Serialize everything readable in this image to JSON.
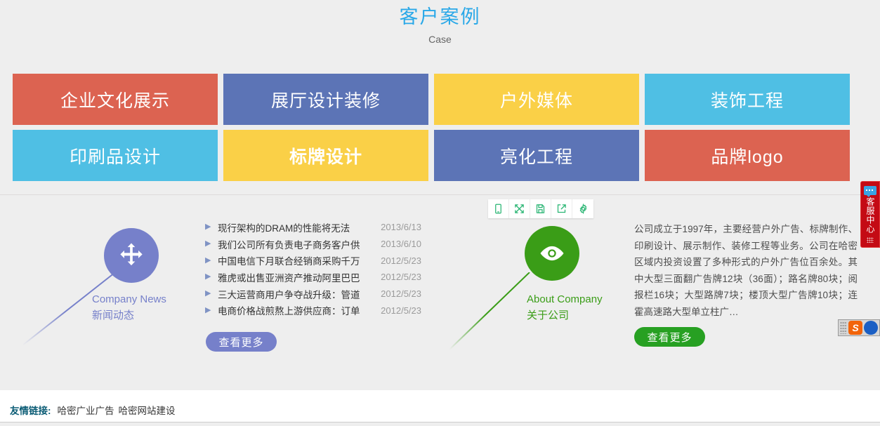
{
  "header": {
    "title": "客户案例",
    "subtitle": "Case"
  },
  "tiles": [
    {
      "label": "企业文化展示",
      "color": "#dc6351",
      "bold": false
    },
    {
      "label": "展厅设计装修",
      "color": "#5c74b6",
      "bold": false
    },
    {
      "label": "户外媒体",
      "color": "#fad047",
      "bold": false
    },
    {
      "label": "装饰工程",
      "color": "#4fbfe4",
      "bold": false
    },
    {
      "label": "印刷品设计",
      "color": "#4fbfe4",
      "bold": false
    },
    {
      "label": "标牌设计",
      "color": "#fad047",
      "bold": true
    },
    {
      "label": "亮化工程",
      "color": "#5c74b6",
      "bold": false
    },
    {
      "label": "品牌logo",
      "color": "#dc6351",
      "bold": false
    }
  ],
  "mini_toolbar": {
    "buttons": [
      {
        "icon": "device-preview-icon",
        "label": "预览"
      },
      {
        "icon": "fullscreen-expand-icon",
        "label": "全屏"
      },
      {
        "icon": "save-floppy-icon",
        "label": "保存"
      },
      {
        "icon": "share-export-icon",
        "label": "分享"
      },
      {
        "icon": "gear-settings-icon",
        "label": "设置"
      }
    ],
    "color": "#29b573"
  },
  "news": {
    "icon": "move-arrows-icon",
    "circle_color": "#7680ca",
    "label_en": "Company News",
    "label_cn": "新闻动态",
    "bullet": "▶",
    "items": [
      {
        "title": "现行架构的DRAM的性能将无法",
        "date": "2013/6/13"
      },
      {
        "title": "我们公司所有负责电子商务客户供",
        "date": "2013/6/10"
      },
      {
        "title": "中国电信下月联合经销商采购千万",
        "date": "2012/5/23"
      },
      {
        "title": "雅虎或出售亚洲资产推动阿里巴巴",
        "date": "2012/5/23"
      },
      {
        "title": "三大运营商用户争夺战升级：管道",
        "date": "2012/5/23"
      },
      {
        "title": "电商价格战煎熬上游供应商：订单",
        "date": "2012/5/23"
      }
    ],
    "more_button": "查看更多"
  },
  "about": {
    "icon": "eye-icon",
    "circle_color": "#3a9d17",
    "label_en": "About Company",
    "label_cn": "关于公司",
    "paragraph": "公司成立于1997年，主要经营户外广告、标牌制作、印刷设计、展示制作、装修工程等业务。公司在哈密区域内投资设置了多种形式的户外广告位百余处。其中大型三面翻广告牌12块（36面）；路名牌80块；阅报栏16块；大型路牌7块；楼顶大型广告牌10块；连霍高速路大型单立柱广…",
    "more_button": "查看更多"
  },
  "footer": {
    "label": "友情链接:",
    "links": [
      "哈密广业广告",
      "哈密网站建设"
    ]
  },
  "service_tab": {
    "icon": "chat-bubble-icon",
    "text": "客服中心",
    "color": "#c40a14"
  },
  "corner_widget": {
    "grip": "drag-grip-icon",
    "icons": [
      {
        "name": "sogou-logo-icon",
        "glyph": "S"
      },
      {
        "name": "blue-circle-icon",
        "glyph": ""
      }
    ]
  }
}
